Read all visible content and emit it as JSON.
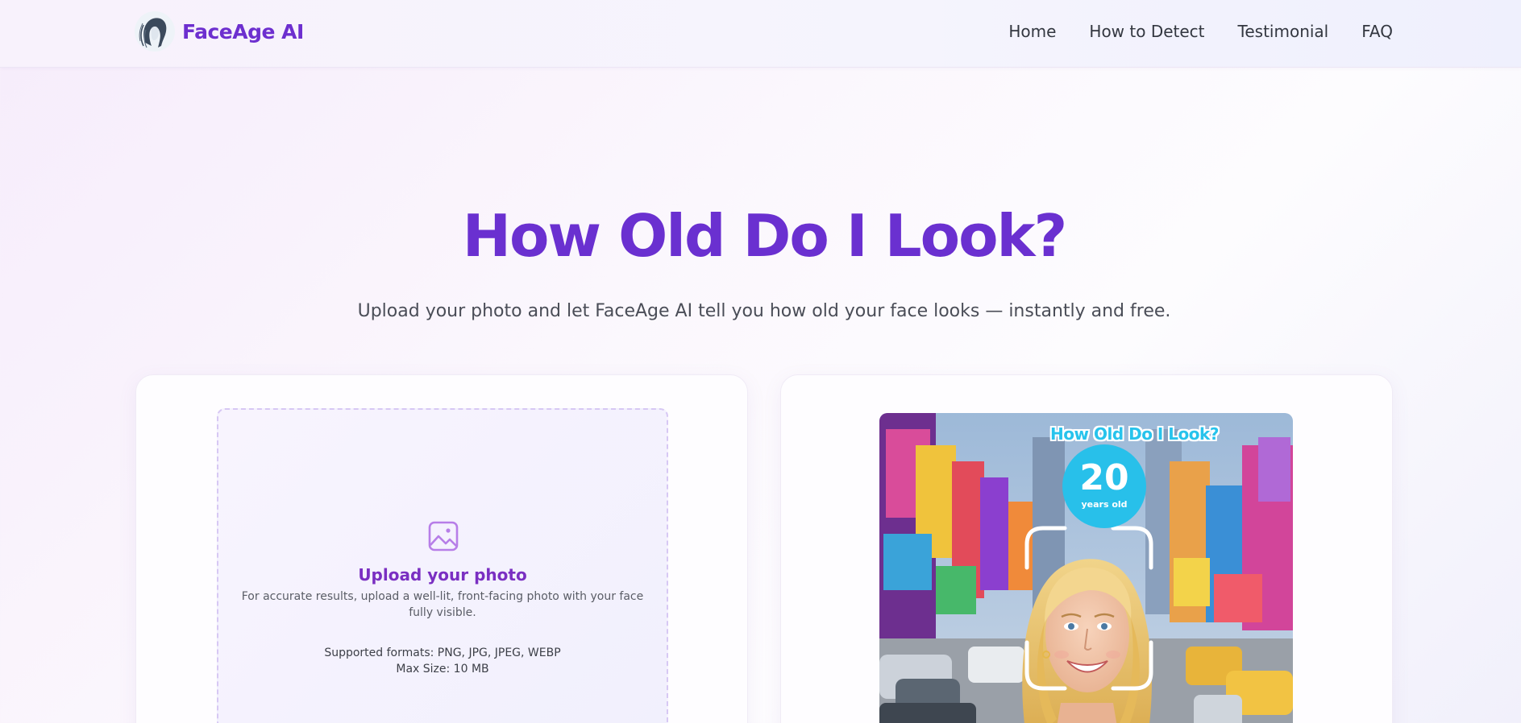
{
  "header": {
    "brand": "FaceAge AI",
    "nav": [
      {
        "label": "Home"
      },
      {
        "label": "How to Detect"
      },
      {
        "label": "Testimonial"
      },
      {
        "label": "FAQ"
      }
    ]
  },
  "hero": {
    "title": "How Old Do I Look?",
    "subtitle": "Upload your photo and let FaceAge AI tell you how old your face looks — instantly and free."
  },
  "upload": {
    "icon": "image-icon",
    "title": "Upload your photo",
    "description": "For accurate results, upload a well-lit, front-facing photo with your face fully visible.",
    "formats": "Supported formats: PNG, JPG, JPEG, WEBP",
    "max_size": "Max Size: 10 MB"
  },
  "sample": {
    "title": "How Old Do I Look?",
    "age": "20",
    "age_unit": "years old"
  },
  "colors": {
    "brand": "#6d2fcf",
    "title_gradient_start": "#7a2fd0",
    "accent_cyan": "#28c0ea"
  }
}
